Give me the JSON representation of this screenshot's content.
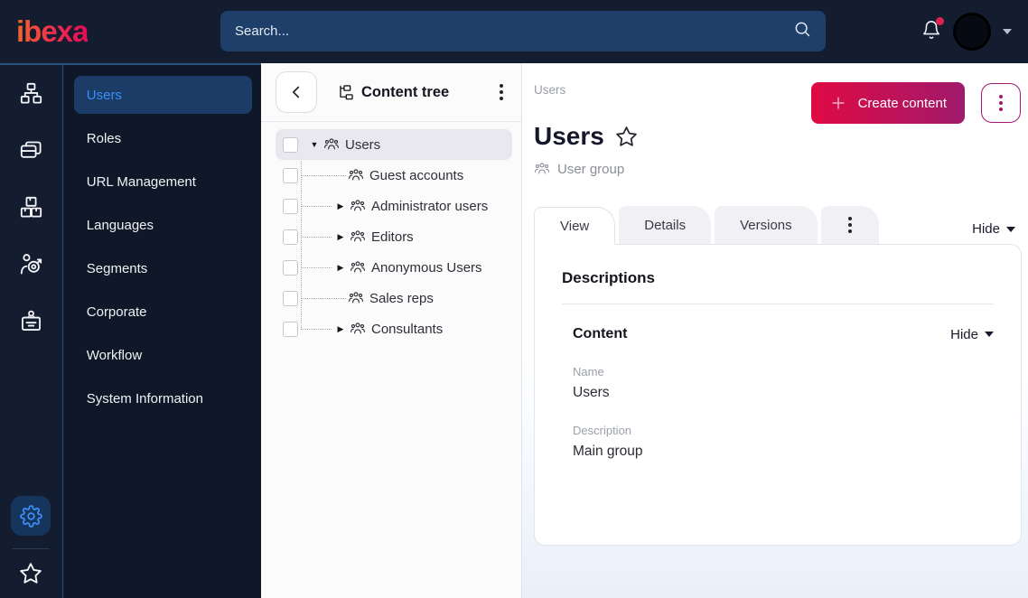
{
  "topbar": {
    "logo_text": "ibexa",
    "search_placeholder": "Search...",
    "has_notification": true
  },
  "icon_rail": {
    "items": [
      "content-structure",
      "admin-pages",
      "product-catalog",
      "customer-segments",
      "corporate-account"
    ],
    "active_bottom": "settings",
    "bookmark": "bookmarks"
  },
  "sidebar": {
    "items": [
      {
        "label": "Users",
        "active": true
      },
      {
        "label": "Roles",
        "active": false
      },
      {
        "label": "URL Management",
        "active": false
      },
      {
        "label": "Languages",
        "active": false
      },
      {
        "label": "Segments",
        "active": false
      },
      {
        "label": "Corporate",
        "active": false
      },
      {
        "label": "Workflow",
        "active": false
      },
      {
        "label": "System Information",
        "active": false
      }
    ]
  },
  "content_tree": {
    "title": "Content tree",
    "items": [
      {
        "label": "Users",
        "caret": "▼",
        "selected": true,
        "level": 0
      },
      {
        "label": "Guest accounts",
        "caret": "",
        "selected": false,
        "level": 1
      },
      {
        "label": "Administrator users",
        "caret": "▶",
        "selected": false,
        "level": 1
      },
      {
        "label": "Editors",
        "caret": "▶",
        "selected": false,
        "level": 1
      },
      {
        "label": "Anonymous Users",
        "caret": "▶",
        "selected": false,
        "level": 1
      },
      {
        "label": "Sales reps",
        "caret": "",
        "selected": false,
        "level": 1
      },
      {
        "label": "Consultants",
        "caret": "▶",
        "selected": false,
        "level": 1
      }
    ]
  },
  "main": {
    "breadcrumb": "Users",
    "create_button_label": "Create content",
    "title": "Users",
    "content_type_label": "User group",
    "tabs": [
      {
        "label": "View",
        "active": true
      },
      {
        "label": "Details",
        "active": false
      },
      {
        "label": "Versions",
        "active": false
      }
    ],
    "hide_label": "Hide",
    "card": {
      "heading": "Descriptions",
      "section": {
        "heading": "Content",
        "hide_label": "Hide"
      },
      "fields": [
        {
          "label": "Name",
          "value": "Users"
        },
        {
          "label": "Description",
          "value": "Main group"
        }
      ]
    }
  },
  "colors": {
    "topbar_bg": "#141c30",
    "menu_bg": "#0e1828",
    "accent_blue": "#3e8ef7",
    "brand_gradient_start": "#e00a43",
    "brand_gradient_end": "#a01a6c",
    "notification_dot": "#e0234e"
  }
}
